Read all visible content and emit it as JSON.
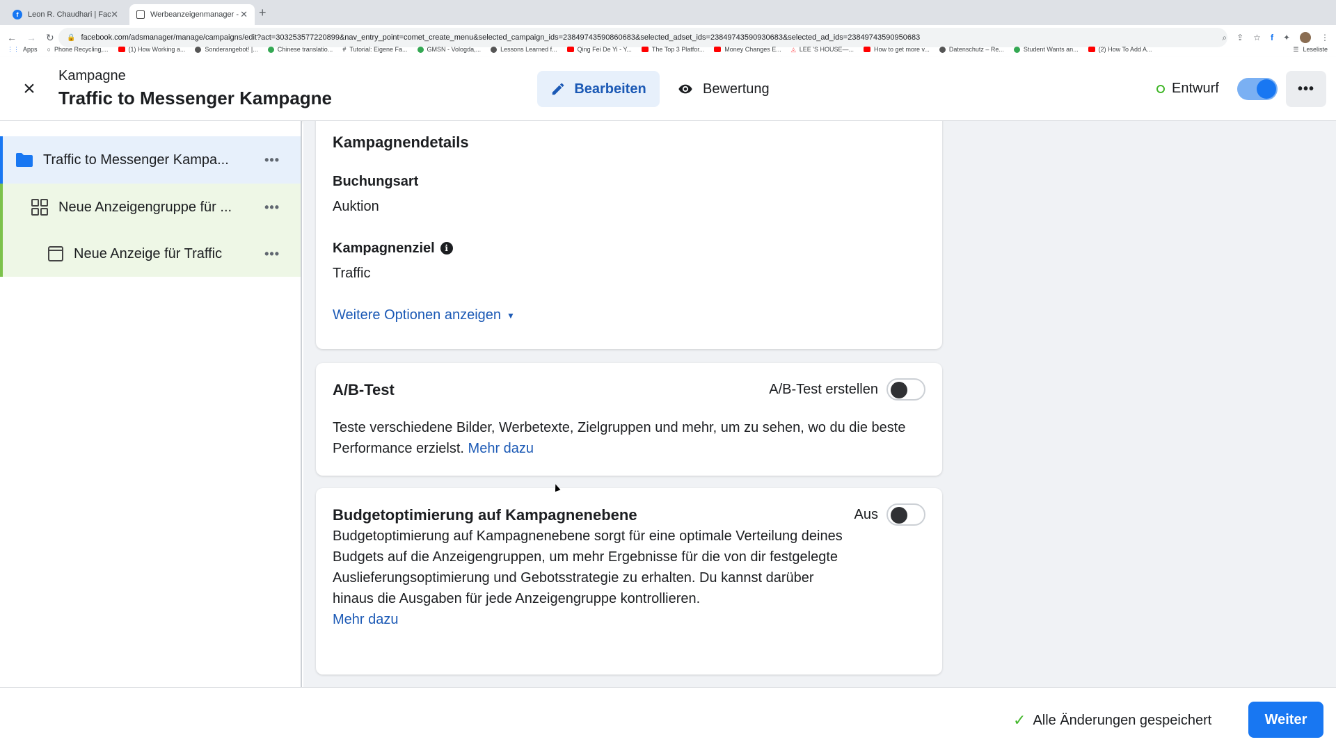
{
  "browser": {
    "tabs": [
      {
        "title": "Leon R. Chaudhari | Facebook"
      },
      {
        "title": "Werbeanzeigenmanager - Wer"
      }
    ],
    "url": "facebook.com/adsmanager/manage/campaigns/edit?act=303253577220899&nav_entry_point=comet_create_menu&selected_campaign_ids=23849743590860683&selected_adset_ids=23849743590930683&selected_ad_ids=23849743590950683",
    "bookmarks": [
      "Apps",
      "Phone Recycling,...",
      "(1) How Working a...",
      "Sonderangebot! |...",
      "Chinese translatio...",
      "Tutorial: Eigene Fa...",
      "GMSN - Vologda,...",
      "Lessons Learned f...",
      "Qing Fei De Yi - Y...",
      "The Top 3 Platfor...",
      "Money Changes E...",
      "LEE 'S HOUSE—...",
      "How to get more v...",
      "Datenschutz – Re...",
      "Student Wants an...",
      "(2) How To Add A..."
    ],
    "reading_list": "Leseliste"
  },
  "header": {
    "subtitle": "Kampagne",
    "title": "Traffic to Messenger Kampagne",
    "edit_label": "Bearbeiten",
    "review_label": "Bewertung",
    "status_label": "Entwurf",
    "more_label": "•••"
  },
  "sidebar": {
    "items": [
      {
        "label": "Traffic to Messenger Kampa...",
        "dots": "•••"
      },
      {
        "label": "Neue Anzeigengruppe für ...",
        "dots": "•••"
      },
      {
        "label": "Neue Anzeige für Traffic",
        "dots": "•••"
      }
    ]
  },
  "campaign_details": {
    "heading": "Kampagnendetails",
    "buying_type_label": "Buchungsart",
    "buying_type_value": "Auktion",
    "objective_label": "Kampagnenziel",
    "objective_value": "Traffic",
    "more_options": "Weitere Optionen anzeigen"
  },
  "ab_test": {
    "heading": "A/B-Test",
    "toggle_label": "A/B-Test erstellen",
    "description": "Teste verschiedene Bilder, Werbetexte, Zielgruppen und mehr, um zu sehen, wo du die beste Performance erzielst.",
    "link": "Mehr dazu"
  },
  "budget": {
    "heading": "Budgetoptimierung auf Kampagnenebene",
    "toggle_label": "Aus",
    "description": "Budgetoptimierung auf Kampagnenebene sorgt für eine optimale Verteilung deines Budgets auf die Anzeigengruppen, um mehr Ergebnisse für die von dir festgelegte Auslieferungsoptimierung und Gebotsstrategie zu erhalten. Du kannst darüber hinaus die Ausgaben für jede Anzeigengruppe kontrollieren.",
    "link": "Mehr dazu"
  },
  "footer": {
    "saved_label": "Alle Änderungen gespeichert",
    "next_label": "Weiter"
  },
  "colors": {
    "accent": "#1877f2",
    "link": "#1b59b5",
    "success": "#42b72a"
  }
}
